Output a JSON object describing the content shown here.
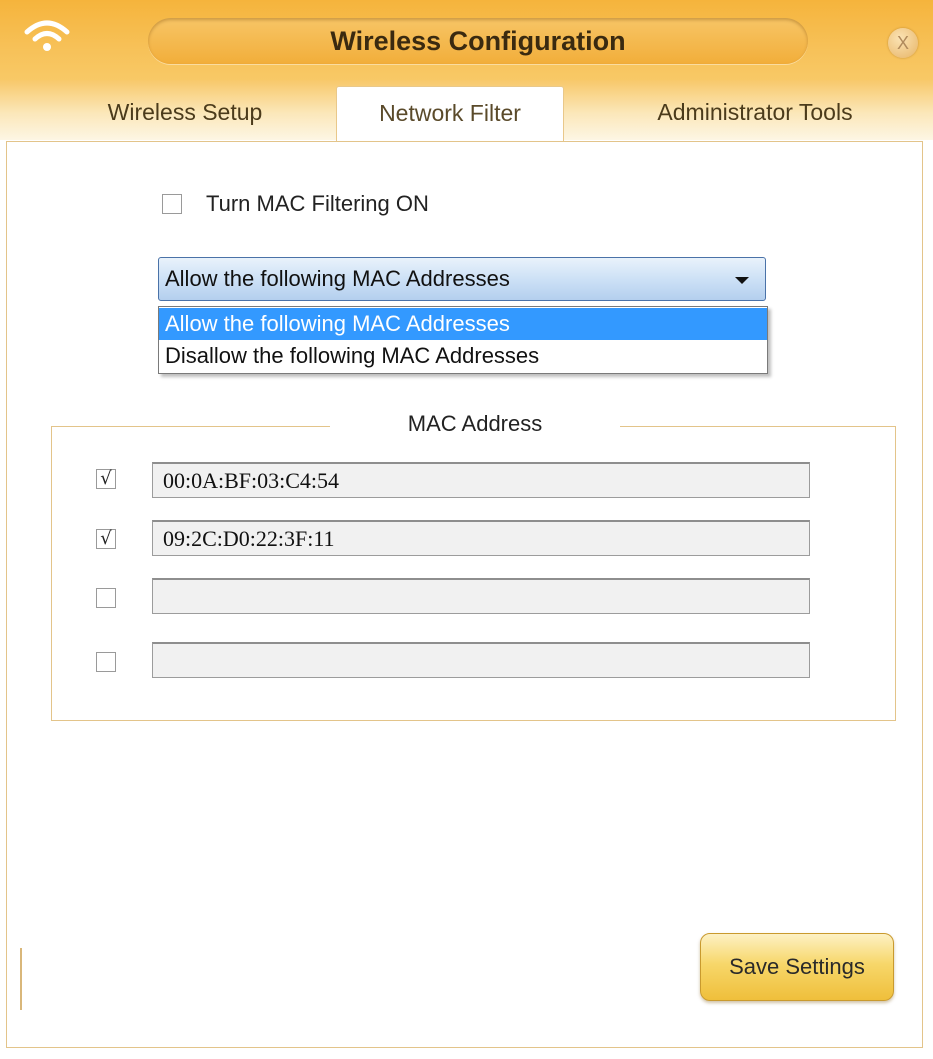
{
  "window": {
    "title": "Wireless Configuration",
    "icon": "wifi-icon",
    "close_glyph": "X"
  },
  "tabs": [
    {
      "label": "Wireless Setup",
      "active": false
    },
    {
      "label": "Network Filter",
      "active": true
    },
    {
      "label": "Administrator Tools",
      "active": false
    }
  ],
  "mac_filter": {
    "toggle_label": "Turn MAC Filtering ON",
    "toggle_checked": false,
    "mode": {
      "selected": "Allow the following MAC Addresses",
      "options": [
        "Allow the following MAC Addresses",
        "Disallow the following MAC Addresses"
      ],
      "highlighted_index": 0
    },
    "group_label": "MAC Address",
    "entries": [
      {
        "checked": true,
        "check_glyph": "√",
        "address": "00:0A:BF:03:C4:54"
      },
      {
        "checked": true,
        "check_glyph": "√",
        "address": "09:2C:D0:22:3F:11"
      },
      {
        "checked": false,
        "check_glyph": "",
        "address": ""
      },
      {
        "checked": false,
        "check_glyph": "",
        "address": ""
      }
    ]
  },
  "actions": {
    "save_label": "Save Settings"
  },
  "colors": {
    "title_bar": "#f5b43c",
    "accent_border": "#e3c48a",
    "selection": "#3399ff"
  }
}
